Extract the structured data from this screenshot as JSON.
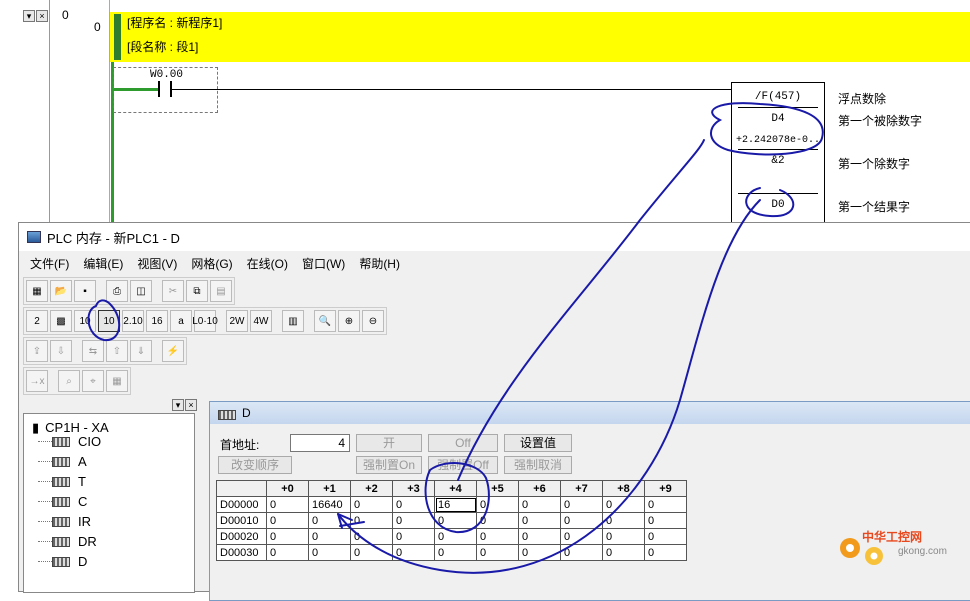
{
  "ladder": {
    "rung_number": "0",
    "rung_address": "0",
    "program_name": "[程序名 : 新程序1]",
    "section_name": "[段名称 : 段1]",
    "contact_label": "W0.00",
    "instruction": "/F(457)",
    "operand1": "D4",
    "operand1_value": "+2.242078e-0..",
    "operand2": "&2",
    "operand3": "D0",
    "comment1": "浮点数除",
    "comment2": "第一个被除数字",
    "comment3": "第一个除数字",
    "comment4": "第一个结果字",
    "rail_color": "#2e9b2e",
    "header_color": "#ffff00"
  },
  "plc_window": {
    "title": "PLC 内存 - 新PLC1 - D",
    "menu": [
      "文件(F)",
      "编辑(E)",
      "视图(V)",
      "网格(G)",
      "在线(O)",
      "窗口(W)",
      "帮助(H)"
    ],
    "toolbar_labels": {
      "bin": "2",
      "dec": "10",
      "dec_signed": "10",
      "dec_dot": "2.10",
      "hex": "16",
      "ascii": "a",
      "float": "L0·10",
      "word2": "2W",
      "word4": "4W"
    },
    "tree": {
      "root": "CP1H - XA",
      "items": [
        "CIO",
        "A",
        "T",
        "C",
        "IR",
        "DR",
        "D"
      ]
    },
    "d_window": {
      "title": "D",
      "start_addr_label": "首地址:",
      "start_addr_value": "4",
      "buttons": {
        "open": "开",
        "off": "Off",
        "set_value": "设置值",
        "change_order": "改变顺序",
        "force_on": "强制置On",
        "force_off": "强制置Off",
        "force_cancel": "强制取消"
      },
      "columns": [
        "+0",
        "+1",
        "+2",
        "+3",
        "+4",
        "+5",
        "+6",
        "+7",
        "+8",
        "+9"
      ],
      "rows": [
        {
          "addr": "D00000",
          "cells": [
            "0",
            "16640",
            "0",
            "0",
            "16",
            "0",
            "0",
            "0",
            "0",
            "0"
          ]
        },
        {
          "addr": "D00010",
          "cells": [
            "0",
            "0",
            "0",
            "0",
            "0",
            "0",
            "0",
            "0",
            "0",
            "0"
          ]
        },
        {
          "addr": "D00020",
          "cells": [
            "0",
            "0",
            "0",
            "0",
            "0",
            "0",
            "0",
            "0",
            "0",
            "0"
          ]
        },
        {
          "addr": "D00030",
          "cells": [
            "0",
            "0",
            "0",
            "0",
            "0",
            "0",
            "0",
            "0",
            "0",
            "0"
          ]
        }
      ]
    }
  },
  "watermark": {
    "text": "中华工控网",
    "url": "gkong.com"
  },
  "annotation_color": "#1a1aa8"
}
